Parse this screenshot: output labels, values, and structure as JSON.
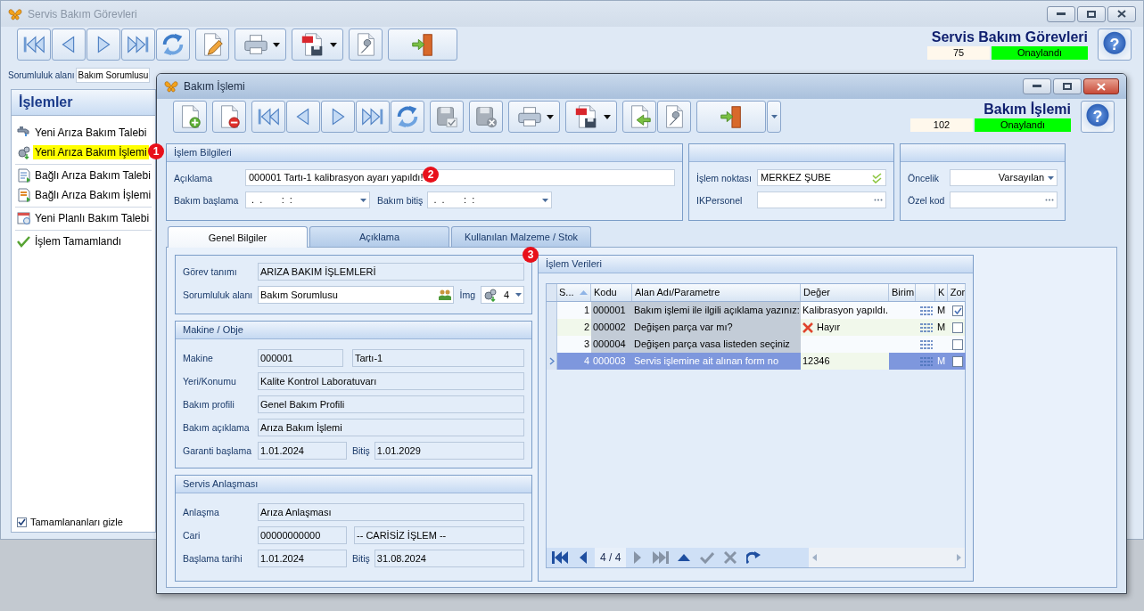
{
  "main_window": {
    "title": "Servis Bakım Görevleri",
    "heading": "Servis Bakım Görevleri",
    "record_no": "75",
    "status": "Onaylandı",
    "help": "?",
    "filter": {
      "label": "Sorumluluk alanı",
      "value": "Bakım Sorumlusu"
    },
    "actions": {
      "title": "İşlemler",
      "groups": [
        {
          "items": [
            {
              "label": "Yeni Arıza Bakım Talebi",
              "selected": false
            },
            {
              "label": "Yeni Arıza Bakım İşlemi",
              "selected": true
            }
          ]
        },
        {
          "items": [
            {
              "label": "Bağlı Arıza Bakım Talebi",
              "selected": false
            },
            {
              "label": "Bağlı Arıza Bakım İşlemi",
              "selected": false
            }
          ]
        },
        {
          "items": [
            {
              "label": "Yeni Planlı Bakım Talebi",
              "selected": false
            }
          ]
        },
        {
          "items": [
            {
              "label": "İşlem Tamamlandı",
              "selected": false
            }
          ]
        }
      ],
      "hide_completed": {
        "label": "Tamamlananları gizle",
        "checked": true
      }
    }
  },
  "dialog": {
    "title": "Bakım İşlemi",
    "heading": "Bakım İşlemi",
    "record_no": "102",
    "status": "Onaylandı",
    "help": "?",
    "info": {
      "title": "İşlem Bilgileri",
      "description": {
        "label": "Açıklama",
        "value": "000001 Tartı-1 kalibrasyon ayarı yapıldı!"
      },
      "start": {
        "label": "Bakım başlama",
        "value": " .  .       :  :"
      },
      "end": {
        "label": "Bakım bitiş",
        "value": " .  .       :  :"
      }
    },
    "location": {
      "point": {
        "label": "İşlem noktası",
        "value": "MERKEZ ŞUBE"
      },
      "personnel": {
        "label": "IKPersonel"
      }
    },
    "priority": {
      "priority": {
        "label": "Öncelik",
        "value": "Varsayılan"
      },
      "special_code": {
        "label": "Özel kod"
      }
    },
    "tabs": [
      {
        "label": "Genel Bilgiler",
        "selected": true
      },
      {
        "label": "Açıklama",
        "selected": false
      },
      {
        "label": "Kullanılan Malzeme / Stok",
        "selected": false
      }
    ],
    "task": {
      "definition": {
        "label": "Görev tanımı",
        "value": "ARIZA BAKIM İŞLEMLERİ"
      },
      "responsibility": {
        "label": "Sorumluluk alanı",
        "value": "Bakım Sorumlusu"
      },
      "image": {
        "label": "İmg",
        "value": "4"
      }
    },
    "machine": {
      "title": "Makine / Obje",
      "machine": {
        "label": "Makine",
        "code": "000001",
        "name": "Tartı-1"
      },
      "location": {
        "label": "Yeri/Konumu",
        "value": "Kalite Kontrol Laboratuvarı"
      },
      "profile": {
        "label": "Bakım profili",
        "value": "Genel Bakım Profili"
      },
      "description": {
        "label": "Bakım açıklama",
        "value": "Arıza Bakım İşlemi"
      },
      "warranty": {
        "label": "Garanti başlama",
        "value": "1.01.2024",
        "end_label": "Bitiş",
        "end_value": "1.01.2029"
      }
    },
    "agreement": {
      "title": "Servis Anlaşması",
      "agreement": {
        "label": "Anlaşma",
        "value": "Arıza Anlaşması"
      },
      "account": {
        "label": "Cari",
        "code": "00000000000",
        "name": "-- CARİSİZ İŞLEM --"
      },
      "start": {
        "label": "Başlama tarihi",
        "value": "1.01.2024",
        "end_label": "Bitiş",
        "end_value": "31.08.2024"
      }
    },
    "data_grid": {
      "title": "İşlem Verileri",
      "columns": [
        {
          "label": "S...",
          "sorted": true
        },
        {
          "label": "Kodu",
          "sorted": false
        },
        {
          "label": "Alan Adı/Parametre",
          "sorted": false
        },
        {
          "label": "Değer",
          "sorted": false
        },
        {
          "label": "Birim",
          "sorted": false
        },
        {
          "label": "K",
          "sorted": false
        },
        {
          "label": "Zor",
          "sorted": false
        }
      ],
      "rows": [
        {
          "no": "1",
          "code": "000001",
          "name": "Bakım işlemi ile ilgili açıklama yazınız:",
          "kind": "text",
          "value": "Kalibrasyon yapıldı.",
          "ka": "M",
          "required": true,
          "selected": false
        },
        {
          "no": "2",
          "code": "000002",
          "name": "Değişen parça var mı?",
          "kind": "boolean",
          "value": "Hayır",
          "ka": "M",
          "required": false,
          "selected": false
        },
        {
          "no": "3",
          "code": "000004",
          "name": "Değişen parça vasa listeden seçiniz",
          "kind": "text",
          "required": false,
          "selected": false
        },
        {
          "no": "4",
          "code": "000003",
          "name": "Servis işlemine ait alınan form no",
          "kind": "text",
          "value": "12346",
          "ka": "M",
          "required": false,
          "selected": true
        }
      ],
      "pager": "4 / 4"
    }
  },
  "markers": [
    {
      "label": "1"
    },
    {
      "label": "2"
    },
    {
      "label": "3"
    }
  ]
}
